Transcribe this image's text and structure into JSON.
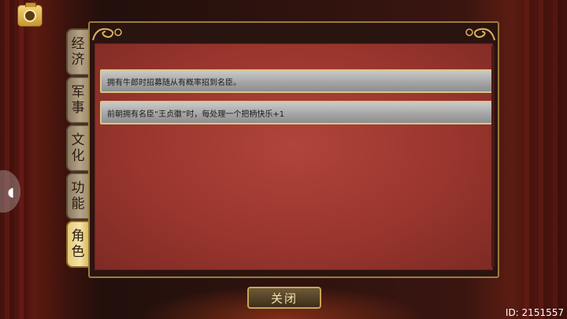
{
  "tabs": [
    {
      "label": "经济",
      "active": false
    },
    {
      "label": "军事",
      "active": false
    },
    {
      "label": "文化",
      "active": false
    },
    {
      "label": "功能",
      "active": false
    },
    {
      "label": "角色",
      "active": true
    }
  ],
  "panel": {
    "rows": [
      {
        "text": "拥有牛郎时招募随从有概率招到名臣。"
      },
      {
        "text": "前朝拥有名臣“王贞徽”时，每处理一个把柄快乐+1"
      }
    ]
  },
  "close_button": {
    "label": "关闭"
  },
  "side_float": {
    "glyph": "◖"
  },
  "footer": {
    "id_text": "ID: 2151557"
  },
  "icons": {
    "camera": "camera-icon"
  }
}
